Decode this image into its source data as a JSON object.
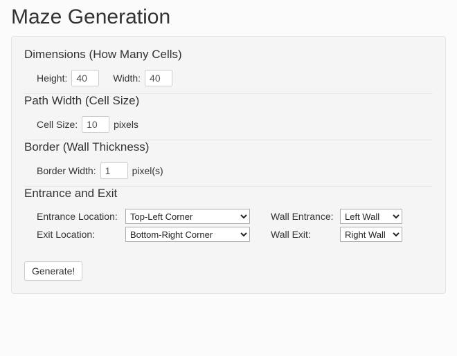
{
  "page_title": "Maze Generation",
  "dimensions": {
    "heading": "Dimensions (How Many Cells)",
    "height_label": "Height:",
    "height_value": "40",
    "width_label": "Width:",
    "width_value": "40"
  },
  "path": {
    "heading": "Path Width (Cell Size)",
    "cellsize_label": "Cell Size:",
    "cellsize_value": "10",
    "cellsize_unit": "pixels"
  },
  "border": {
    "heading": "Border (Wall Thickness)",
    "borderwidth_label": "Border Width:",
    "borderwidth_value": "1",
    "borderwidth_unit": "pixel(s)"
  },
  "entrance_exit": {
    "heading": "Entrance and Exit",
    "entrance_loc_label": "Entrance Location:",
    "entrance_loc_value": "Top-Left Corner",
    "exit_loc_label": "Exit Location:",
    "exit_loc_value": "Bottom-Right Corner",
    "wall_entrance_label": "Wall Entrance:",
    "wall_entrance_value": "Left Wall",
    "wall_exit_label": "Wall Exit:",
    "wall_exit_value": "Right Wall"
  },
  "generate_button": "Generate!"
}
